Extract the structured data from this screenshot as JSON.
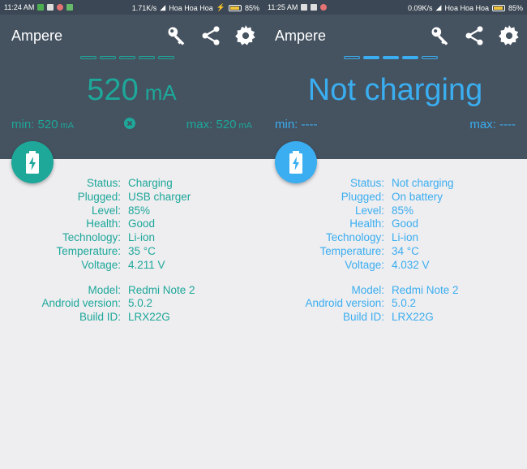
{
  "colors": {
    "teal": "#1da89a",
    "blue": "#3aaef0",
    "header": "#455260",
    "statusbar": "#3b4754",
    "background": "#eeedf0"
  },
  "left": {
    "statusbar": {
      "time": "11:24 AM",
      "speed": "1.71K/s",
      "carrier": "Hoa Hoa Hoa",
      "battery": "85%"
    },
    "app_title": "Ampere",
    "progress_filled": [
      false,
      false,
      false,
      false,
      false
    ],
    "main_value": "520",
    "main_unit": "mA",
    "min_label": "min:",
    "min_value": "520",
    "min_unit": "mA",
    "max_label": "max:",
    "max_value": "520",
    "max_unit": "mA",
    "info": [
      {
        "label": "Status:",
        "value": "Charging"
      },
      {
        "label": "Plugged:",
        "value": "USB charger"
      },
      {
        "label": "Level:",
        "value": "85%"
      },
      {
        "label": "Health:",
        "value": "Good"
      },
      {
        "label": "Technology:",
        "value": "Li-ion"
      },
      {
        "label": "Temperature:",
        "value": "35 °C"
      },
      {
        "label": "Voltage:",
        "value": "4.211 V"
      }
    ],
    "device": [
      {
        "label": "Model:",
        "value": "Redmi Note 2"
      },
      {
        "label": "Android version:",
        "value": "5.0.2"
      },
      {
        "label": "Build ID:",
        "value": "LRX22G"
      }
    ]
  },
  "right": {
    "statusbar": {
      "time": "11:25 AM",
      "speed": "0.09K/s",
      "carrier": "Hoa Hoa Hoa",
      "battery": "85%"
    },
    "app_title": "Ampere",
    "progress_filled": [
      false,
      true,
      true,
      true,
      false
    ],
    "main_value": "Not charging",
    "min_label": "min:",
    "min_value": "----",
    "max_label": "max:",
    "max_value": "----",
    "info": [
      {
        "label": "Status:",
        "value": "Not charging"
      },
      {
        "label": "Plugged:",
        "value": "On battery"
      },
      {
        "label": "Level:",
        "value": "85%"
      },
      {
        "label": "Health:",
        "value": "Good"
      },
      {
        "label": "Technology:",
        "value": "Li-ion"
      },
      {
        "label": "Temperature:",
        "value": "34 °C"
      },
      {
        "label": "Voltage:",
        "value": "4.032 V"
      }
    ],
    "device": [
      {
        "label": "Model:",
        "value": "Redmi Note 2"
      },
      {
        "label": "Android version:",
        "value": "5.0.2"
      },
      {
        "label": "Build ID:",
        "value": "LRX22G"
      }
    ]
  }
}
